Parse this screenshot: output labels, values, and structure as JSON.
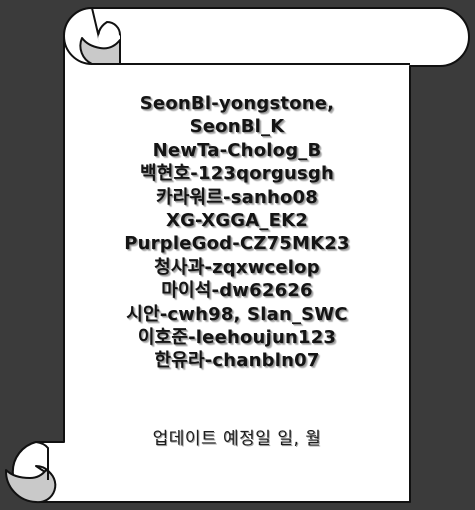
{
  "credits": {
    "lines": [
      "SeonBl-yongstone,",
      "SeonBl_K",
      "NewTa-Cholog_B",
      "백현호-123qorgusgh",
      "카라워르-sanho08",
      "XG-XGGA_EK2",
      "PurpleGod-CZ75MK23",
      "청사과-zqxwcelop",
      "마이석-dw62626",
      "시안-cwh98, Slan_SWC",
      "이호준-leehoujun123",
      "한유라-chanbln07"
    ]
  },
  "footer": {
    "update_label": "업데이트 예정일 일, 월"
  },
  "colors": {
    "background": "#3b3b3b",
    "paper": "#ffffff",
    "curl": "#c9c9c9",
    "text": "#141414"
  }
}
